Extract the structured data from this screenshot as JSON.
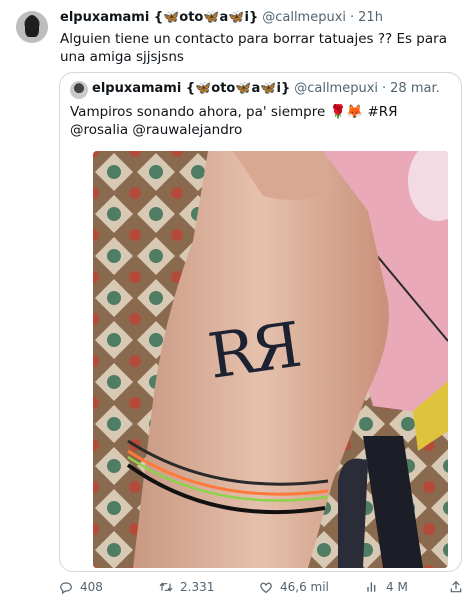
{
  "tweet": {
    "author_name": "elpuxamami {🦋oto🦋a🦋i}",
    "handle": "@callmepuxi",
    "separator": "·",
    "time": "21h",
    "text": "Alguien tiene un contacto para borrar tatuajes ?? Es para una amiga sjjsjsns"
  },
  "quote": {
    "author_name": "elpuxamami {🦋oto🦋a🦋i}",
    "handle": "@callmepuxi",
    "separator": "·",
    "time": "28 mar.",
    "text": "Vampiros sonando ahora, pa' siempre 🌹🦊 #RЯ @rosalia @rauwalejandro",
    "photo_text": "RЯ"
  },
  "actions": {
    "replies": "408",
    "retweets": "2.331",
    "likes": "46,6 mil",
    "views": "4 M"
  }
}
